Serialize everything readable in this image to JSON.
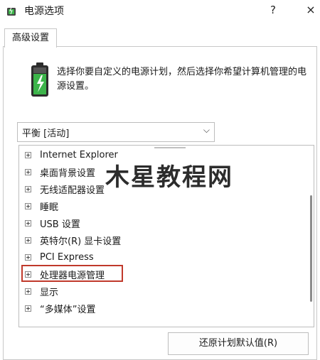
{
  "window": {
    "title": "电源选项",
    "help": "?",
    "close": "×"
  },
  "tab": {
    "label": "高级设置"
  },
  "description": "选择你要自定义的电源计划，然后选择你希望计算机管理的电源设置。",
  "plan_select": {
    "value": "平衡 [活动]",
    "chevron": "⌵"
  },
  "tree": {
    "items": [
      {
        "label": "Internet Explorer"
      },
      {
        "label": "桌面背景设置"
      },
      {
        "label": "无线适配器设置"
      },
      {
        "label": "睡眠"
      },
      {
        "label": "USB 设置"
      },
      {
        "label": "英特尔(R) 显卡设置"
      },
      {
        "label": "PCI Express"
      },
      {
        "label": "处理器电源管理"
      },
      {
        "label": "显示"
      },
      {
        "label": "“多媒体”设置"
      }
    ],
    "highlighted_index": 7
  },
  "restore_button": "还原计划默认值(R)",
  "watermark": "木星教程网",
  "colors": {
    "highlight": "#c0392b",
    "battery_green": "#3cb44a"
  }
}
